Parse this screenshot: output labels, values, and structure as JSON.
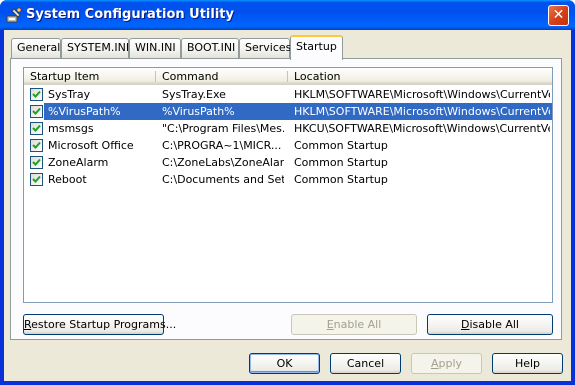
{
  "window": {
    "title": "System Configuration Utility",
    "close_glyph": "✕"
  },
  "tabs": [
    {
      "label": "General",
      "active": false
    },
    {
      "label": "SYSTEM.INI",
      "active": false
    },
    {
      "label": "WIN.INI",
      "active": false
    },
    {
      "label": "BOOT.INI",
      "active": false
    },
    {
      "label": "Services",
      "active": false
    },
    {
      "label": "Startup",
      "active": true
    }
  ],
  "startup": {
    "columns": [
      "Startup Item",
      "Command",
      "Location"
    ],
    "rows": [
      {
        "checked": true,
        "item": "SysTray",
        "command": "SysTray.Exe",
        "location": "HKLM\\SOFTWARE\\Microsoft\\Windows\\CurrentVer...",
        "selected": false
      },
      {
        "checked": true,
        "item": "%VirusPath%",
        "command": "%VirusPath%",
        "location": "HKLM\\SOFTWARE\\Microsoft\\Windows\\CurrentVer...",
        "selected": true
      },
      {
        "checked": true,
        "item": "msmsgs",
        "command": "\"C:\\Program Files\\Mes...",
        "location": "HKCU\\SOFTWARE\\Microsoft\\Windows\\CurrentVer...",
        "selected": false
      },
      {
        "checked": true,
        "item": "Microsoft Office",
        "command": "C:\\PROGRA~1\\MICR...",
        "location": "Common Startup",
        "selected": false
      },
      {
        "checked": true,
        "item": "ZoneAlarm",
        "command": "C:\\ZoneLabs\\ZoneAlar...",
        "location": "Common Startup",
        "selected": false
      },
      {
        "checked": true,
        "item": "Reboot",
        "command": "C:\\Documents and Set...",
        "location": "Common Startup",
        "selected": false
      }
    ],
    "restore_button": {
      "accel": "R",
      "rest": "estore Startup Programs..."
    },
    "enable_all_button": {
      "accel": "E",
      "rest": "nable All",
      "enabled": false
    },
    "disable_all_button": {
      "accel": "D",
      "rest": "isable All",
      "enabled": true
    }
  },
  "footer": {
    "ok_label": "OK",
    "cancel_label": "Cancel",
    "apply_accel": "A",
    "apply_rest": "pply",
    "apply_enabled": false,
    "help_label": "Help"
  },
  "colors": {
    "selection": "#316ac5",
    "title_bar": "#0053ee",
    "client_bg": "#ece9d8",
    "active_tab_accent": "#ffc83c"
  },
  "icons": {
    "title": "msconfig-app-icon",
    "check": "checkmark-icon",
    "close": "close-icon"
  }
}
